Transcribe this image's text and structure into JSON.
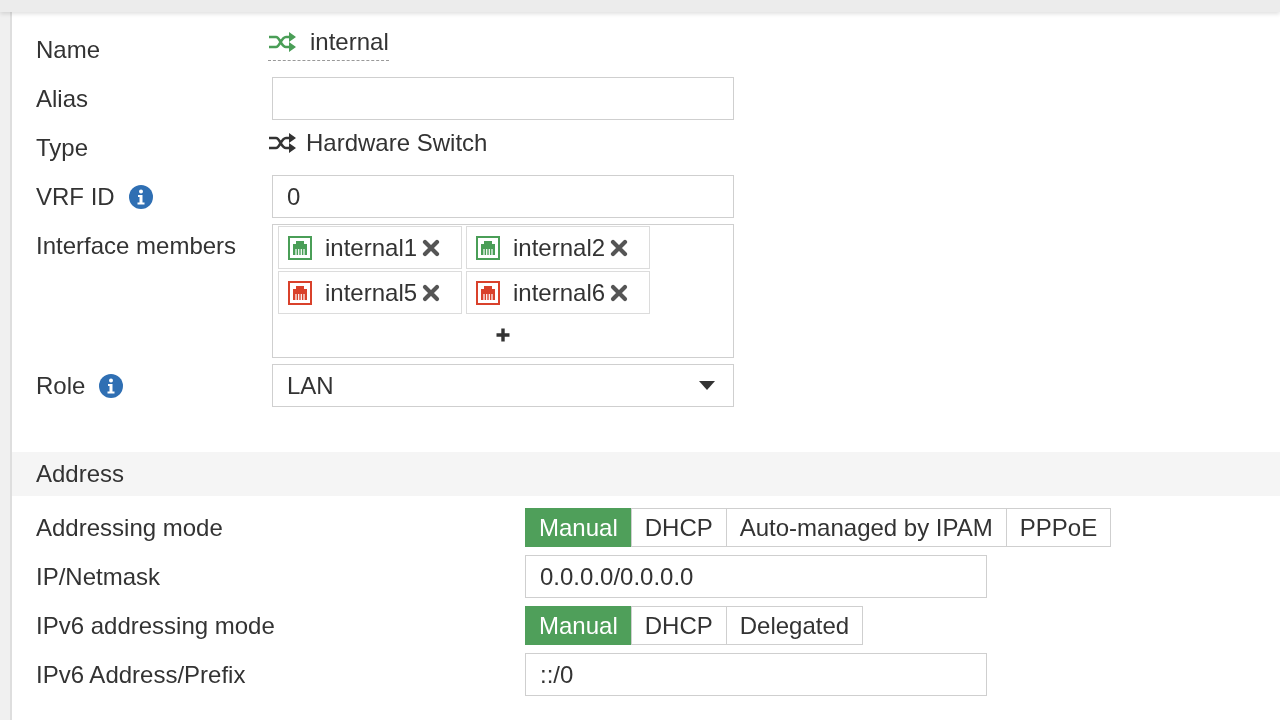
{
  "general": {
    "fields": [
      {
        "kind": "name",
        "label": "Name",
        "value": "internal"
      },
      {
        "kind": "input",
        "label": "Alias"
      },
      {
        "kind": "type",
        "label": "Type",
        "value": "Hardware Switch"
      },
      {
        "kind": "input",
        "label": "VRF ID",
        "info": true,
        "value": "0"
      },
      {
        "kind": "members",
        "label": "Interface members",
        "members": [
          {
            "name": "internal1",
            "color": "#4a9e57"
          },
          {
            "name": "internal2",
            "color": "#4a9e57"
          },
          {
            "name": "internal5",
            "color": "#d9412b"
          },
          {
            "name": "internal6",
            "color": "#d9412b"
          }
        ]
      },
      {
        "kind": "select",
        "label": "Role",
        "info": true,
        "value": "LAN"
      }
    ]
  },
  "address": {
    "title": "Address",
    "fields": [
      {
        "kind": "buttons",
        "label": "Addressing mode",
        "options": [
          {
            "label": "Manual",
            "selected": true
          },
          {
            "label": "DHCP",
            "selected": false
          },
          {
            "label": "Auto-managed by IPAM",
            "selected": false
          },
          {
            "label": "PPPoE",
            "selected": false
          }
        ]
      },
      {
        "kind": "input",
        "label": "IP/Netmask",
        "value": "0.0.0.0/0.0.0.0"
      },
      {
        "kind": "buttons",
        "label": "IPv6 addressing mode",
        "options": [
          {
            "label": "Manual",
            "selected": true
          },
          {
            "label": "DHCP",
            "selected": false
          },
          {
            "label": "Delegated",
            "selected": false
          }
        ]
      },
      {
        "kind": "input",
        "label": "IPv6 Address/Prefix",
        "value": "::/0"
      }
    ]
  }
}
